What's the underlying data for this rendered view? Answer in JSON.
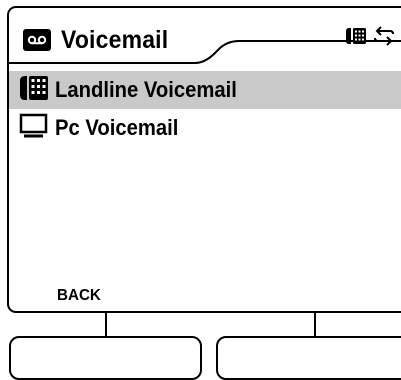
{
  "header": {
    "title": "Voicemail",
    "title_icon": "voicemail-icon",
    "status_icons": [
      "desk-phone-icon",
      "sync-icon"
    ]
  },
  "menu": {
    "items": [
      {
        "label": "Landline Voicemail",
        "icon": "desk-phone-icon",
        "selected": true
      },
      {
        "label": "Pc Voicemail",
        "icon": "monitor-icon",
        "selected": false
      }
    ]
  },
  "softkeys": {
    "left_label": "BACK",
    "right_label": ""
  },
  "colors": {
    "selection": "#c9c9c9",
    "foreground": "#000000",
    "background": "#ffffff"
  }
}
